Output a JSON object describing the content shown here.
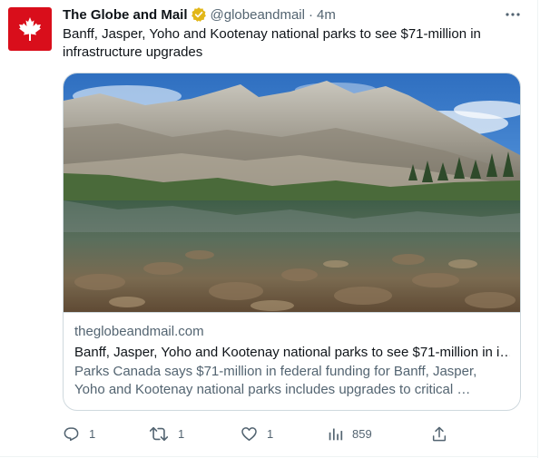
{
  "tweet": {
    "author_name": "The Globe and Mail",
    "handle": "@globeandmail",
    "separator": "·",
    "time": "4m",
    "text": "Banff, Jasper, Yoho and Kootenay national parks to see $71-million in infrastructure upgrades"
  },
  "card": {
    "domain": "theglobeandmail.com",
    "title": "Banff, Jasper, Yoho and Kootenay national parks to see $71-million in i…",
    "description": "Parks Canada says $71-million in federal funding for Banff, Jasper, Yoho and Kootenay national parks includes upgrades to critical …"
  },
  "actions": {
    "reply_count": "1",
    "retweet_count": "1",
    "like_count": "1",
    "views_count": "859"
  },
  "icons": {
    "avatar": "maple-leaf-icon",
    "verified": "verified-badge-icon",
    "more": "more-icon",
    "reply": "reply-icon",
    "retweet": "retweet-icon",
    "like": "heart-icon",
    "views": "views-icon",
    "share": "share-icon"
  },
  "colors": {
    "brand_red": "#d90e1b",
    "verified_gold": "#e2b719",
    "secondary_text": "#536471",
    "primary_text": "#0f1419",
    "border": "#cfd9de"
  }
}
